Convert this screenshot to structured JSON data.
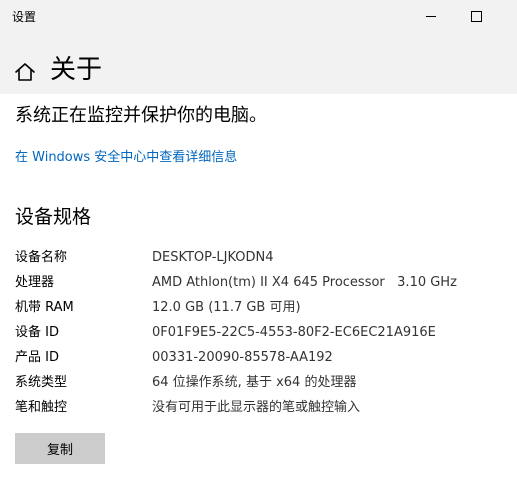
{
  "window": {
    "title": "设置",
    "controls": [
      "minimize",
      "maximize",
      "close"
    ]
  },
  "header": {
    "home_icon": "home-icon",
    "page_title": "关于"
  },
  "protection": {
    "status_text": "系统正在监控并保护你的电脑。",
    "link_text": "在 Windows 安全中心中查看详细信息"
  },
  "device_specs": {
    "section_title": "设备规格",
    "rows": [
      {
        "label": "设备名称",
        "value": "DESKTOP-LJKODN4"
      },
      {
        "label": "处理器",
        "value": "AMD Athlon(tm) II X4 645 Processor   3.10 GHz"
      },
      {
        "label": "机带 RAM",
        "value": "12.0 GB (11.7 GB 可用)"
      },
      {
        "label": "设备 ID",
        "value": "0F01F9E5-22C5-4553-80F2-EC6EC21A916E"
      },
      {
        "label": "产品 ID",
        "value": "00331-20090-85578-AA192"
      },
      {
        "label": "系统类型",
        "value": "64 位操作系统, 基于 x64 的处理器"
      },
      {
        "label": "笔和触控",
        "value": "没有可用于此显示器的笔或触控输入"
      }
    ],
    "copy_button_label": "复制"
  },
  "colors": {
    "link": "#0067c0",
    "header_background": "#f2f2f2",
    "button_background": "#cccccc"
  }
}
